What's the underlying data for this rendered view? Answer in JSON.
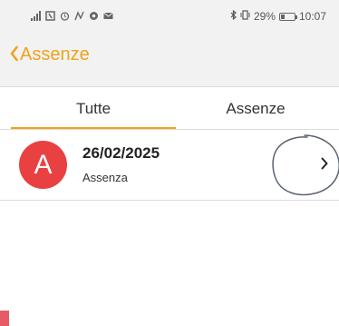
{
  "status_bar": {
    "battery": "29%",
    "battery_level": 0.29,
    "time": "10:07"
  },
  "navbar": {
    "back_label": "Assenze",
    "accent_color": "#f0a21a"
  },
  "tabs": [
    {
      "label": "Tutte",
      "selected": true
    },
    {
      "label": "Assenze",
      "selected": false
    }
  ],
  "list": {
    "items": [
      {
        "avatar_letter": "A",
        "date": "26/02/2025",
        "type": "Assenza",
        "avatar_color": "#e94141"
      }
    ]
  }
}
